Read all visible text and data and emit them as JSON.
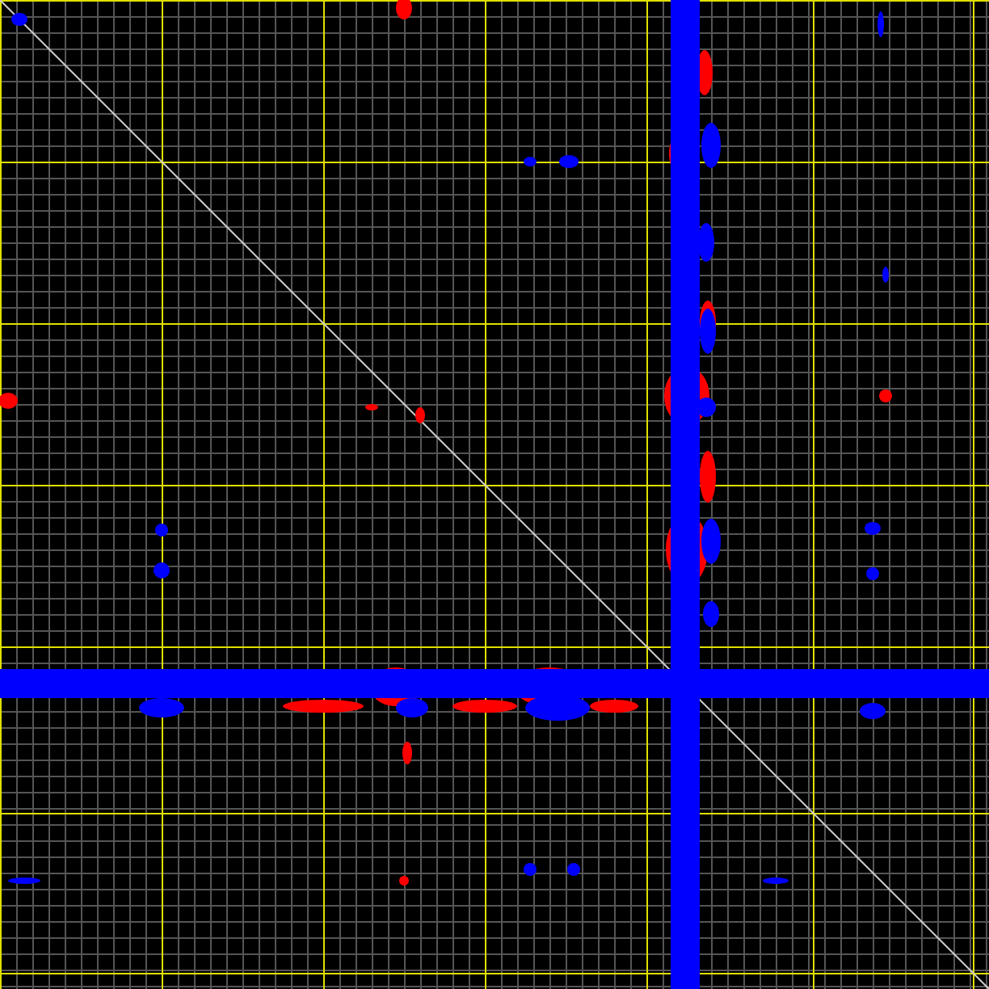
{
  "contour_sets": [
    {
      "kind": "positive",
      "color": "#ff0000"
    },
    {
      "kind": "negative",
      "color": "#0000ff"
    }
  ]
}
